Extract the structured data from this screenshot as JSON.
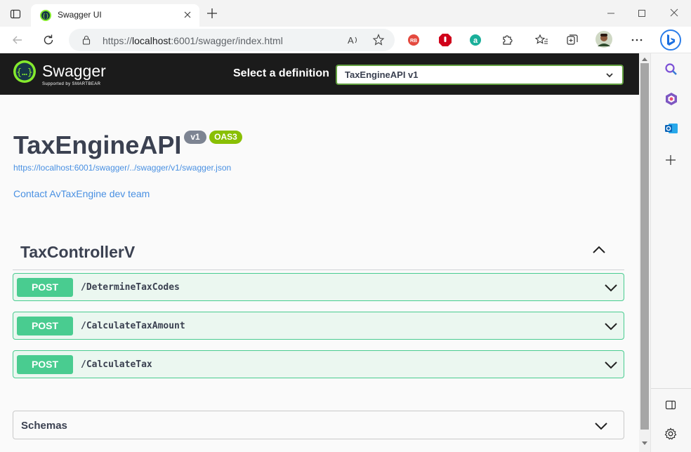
{
  "browser": {
    "tab_title": "Swagger UI",
    "url_prefix": "https://",
    "url_host": "localhost",
    "url_rest": ":6001/swagger/index.html",
    "toolbar_icons": [
      "back-icon",
      "refresh-icon",
      "lock-icon",
      "read-aloud-icon",
      "favorite-add-icon",
      "extension-icon",
      "favorites-icon",
      "collections-icon",
      "profile-avatar",
      "more-icon",
      "bing-icon"
    ],
    "sidebar_icons": [
      "search-icon",
      "office-icon",
      "outlook-icon",
      "add-icon",
      "split-icon",
      "settings-icon"
    ]
  },
  "header": {
    "logo_text": "Swagger",
    "logo_sub": "Supported by SMARTBEAR",
    "select_label": "Select a definition",
    "selected_definition": "TaxEngineAPI v1",
    "accent_color": "#62a03f"
  },
  "info": {
    "title": "TaxEngineAPI",
    "version_badge": "v1",
    "oas_badge": "OAS3",
    "spec_url": "https://localhost:6001/swagger/../swagger/v1/swagger.json",
    "contact": "Contact AvTaxEngine dev team"
  },
  "tag": {
    "name": "TaxControllerV",
    "operations": [
      {
        "method": "POST",
        "path": "/DetermineTaxCodes"
      },
      {
        "method": "POST",
        "path": "/CalculateTaxAmount"
      },
      {
        "method": "POST",
        "path": "/CalculateTax"
      }
    ]
  },
  "schemas": {
    "label": "Schemas"
  },
  "colors": {
    "post": "#49cc90",
    "post_bg": "#ebf7f0",
    "link": "#4990e2",
    "text": "#3b4151"
  }
}
